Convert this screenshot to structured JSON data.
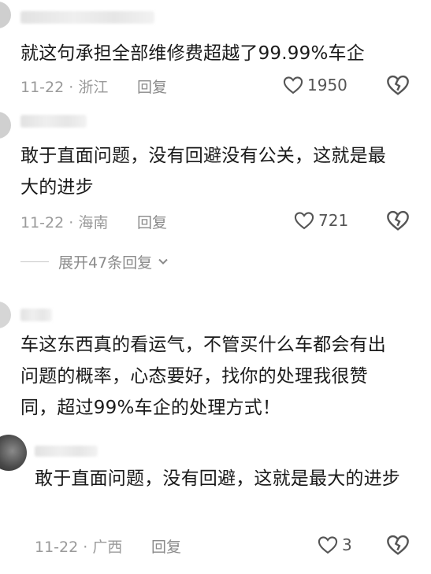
{
  "comments": [
    {
      "text": "就这句承担全部维修费超越了99.99%车企",
      "date_location": "11-22 · 浙江",
      "reply_label": "回复",
      "likes": "1950"
    },
    {
      "text": "敢于直面问题，没有回避没有公关，这就是最大的进步",
      "date_location": "11-22 · 海南",
      "reply_label": "回复",
      "likes": "721",
      "expand_label": "展开47条回复"
    },
    {
      "text": "车这东西真的看运气，不管买什么车都会有出问题的概率，心态要好，找你的处理我很赞同，超过99%车企的处理方式！"
    },
    {
      "text": "敢于直面问题，没有回避，这就是最大的进步",
      "date_location": "11-22 · 广西",
      "reply_label": "回复",
      "likes": "3"
    }
  ],
  "icons": {
    "like": "heart-outline-icon",
    "dislike": "broken-heart-icon",
    "expand": "chevron-down-icon"
  },
  "colors": {
    "text": "#1a1a1a",
    "meta": "#9a9a9a",
    "icon": "#555555"
  }
}
